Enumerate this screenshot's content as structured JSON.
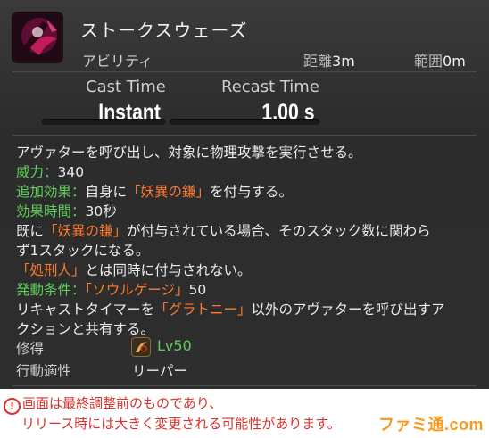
{
  "tooltip": {
    "name": "ストークスウェーズ",
    "category": "アビリティ",
    "range_label": "距離",
    "range_value": "3m",
    "radius_label": "範囲",
    "radius_value": "0m",
    "cast_label": "Cast Time",
    "cast_value": "Instant",
    "recast_label": "Recast Time",
    "recast_value": "1.00 s",
    "description": {
      "line1": "アヴァターを呼び出し、対象に物理攻撃を実行させる。",
      "potency_label": "威力：",
      "potency_value": "340",
      "additional_effect_label": "追加効果：",
      "additional_effect_pre": "自身に",
      "status_1": "「妖異の鎌」",
      "additional_effect_post": "を付与する。",
      "duration_label": "効果時間：",
      "duration_value": "30秒",
      "line5_pre": "既に",
      "status_2": "「妖異の鎌」",
      "line5_post": "が付与されている場合、そのスタック数に関わら",
      "line6": "ず1スタックになる。",
      "status_3": "「処刑人」",
      "line7_post": "とは同時に付与されない。",
      "condition_label": "発動条件：",
      "gauge_name": "「ソウルゲージ」",
      "gauge_value": "50",
      "line9_pre": "リキャストタイマーを",
      "status_4": "「グラトニー」",
      "line9_post": "以外のアヴァターを呼び出すア",
      "line10": "クションと共有する。"
    },
    "acquired_label": "修得",
    "acquired_level": "Lv50",
    "affinity_label": "行動適性",
    "affinity_value": "リーパー"
  },
  "footer": {
    "warning_symbol": "!",
    "note_line1": "画面は最終調整前のものであり、",
    "note_line2": "リリース時には大きく変更される可能性があります。",
    "logo_text": "ファミ通.com"
  },
  "colors": {
    "green": "#5ecf5a",
    "orange": "#ff7a2e",
    "warning_red": "#d9312b"
  }
}
